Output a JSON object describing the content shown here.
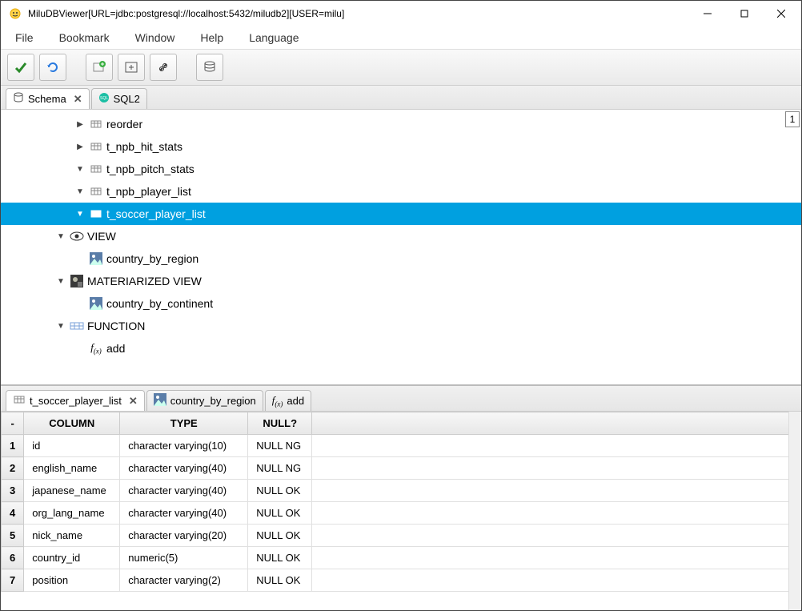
{
  "window": {
    "title": "MiluDBViewer[URL=jdbc:postgresql://localhost:5432/miludb2][USER=milu]"
  },
  "menu": {
    "file": "File",
    "bookmark": "Bookmark",
    "window": "Window",
    "help": "Help",
    "language": "Language"
  },
  "topTabs": {
    "schema": "Schema",
    "sql2": "SQL2"
  },
  "cornerBox": "1",
  "tree": [
    {
      "indent": 3,
      "toggle": "▶",
      "icon": "table",
      "label": "reorder",
      "selected": false
    },
    {
      "indent": 3,
      "toggle": "▶",
      "icon": "table",
      "label": "t_npb_hit_stats",
      "selected": false
    },
    {
      "indent": 3,
      "toggle": "▼",
      "icon": "table",
      "label": "t_npb_pitch_stats",
      "selected": false
    },
    {
      "indent": 3,
      "toggle": "▼",
      "icon": "table",
      "label": "t_npb_player_list",
      "selected": false
    },
    {
      "indent": 3,
      "toggle": "▼",
      "icon": "table",
      "label": "t_soccer_player_list",
      "selected": true
    },
    {
      "indent": 2,
      "toggle": "▼",
      "icon": "eye",
      "label": "VIEW",
      "selected": false
    },
    {
      "indent": 3,
      "toggle": "",
      "icon": "img",
      "label": "country_by_region",
      "selected": false
    },
    {
      "indent": 2,
      "toggle": "▼",
      "icon": "img2",
      "label": "MATERIARIZED VIEW",
      "selected": false
    },
    {
      "indent": 3,
      "toggle": "",
      "icon": "img",
      "label": "country_by_continent",
      "selected": false
    },
    {
      "indent": 2,
      "toggle": "▼",
      "icon": "func",
      "label": "FUNCTION",
      "selected": false
    },
    {
      "indent": 3,
      "toggle": "",
      "icon": "fx",
      "label": "add",
      "selected": false
    }
  ],
  "bottomTabs": [
    {
      "icon": "table",
      "label": "t_soccer_player_list",
      "close": true,
      "active": true
    },
    {
      "icon": "img",
      "label": "country_by_region",
      "close": false,
      "active": false
    },
    {
      "icon": "fx",
      "label": "add",
      "close": false,
      "active": false
    }
  ],
  "tableHeaders": {
    "row": "-",
    "column": "COLUMN",
    "type": "TYPE",
    "null": "NULL?"
  },
  "tableRows": [
    {
      "n": "1",
      "column": "id",
      "type": "character varying(10)",
      "null": "NULL NG"
    },
    {
      "n": "2",
      "column": "english_name",
      "type": "character varying(40)",
      "null": "NULL NG"
    },
    {
      "n": "3",
      "column": "japanese_name",
      "type": "character varying(40)",
      "null": "NULL OK"
    },
    {
      "n": "4",
      "column": "org_lang_name",
      "type": "character varying(40)",
      "null": "NULL OK"
    },
    {
      "n": "5",
      "column": "nick_name",
      "type": "character varying(20)",
      "null": "NULL OK"
    },
    {
      "n": "6",
      "column": "country_id",
      "type": "numeric(5)",
      "null": "NULL OK"
    },
    {
      "n": "7",
      "column": "position",
      "type": "character varying(2)",
      "null": "NULL OK"
    }
  ]
}
